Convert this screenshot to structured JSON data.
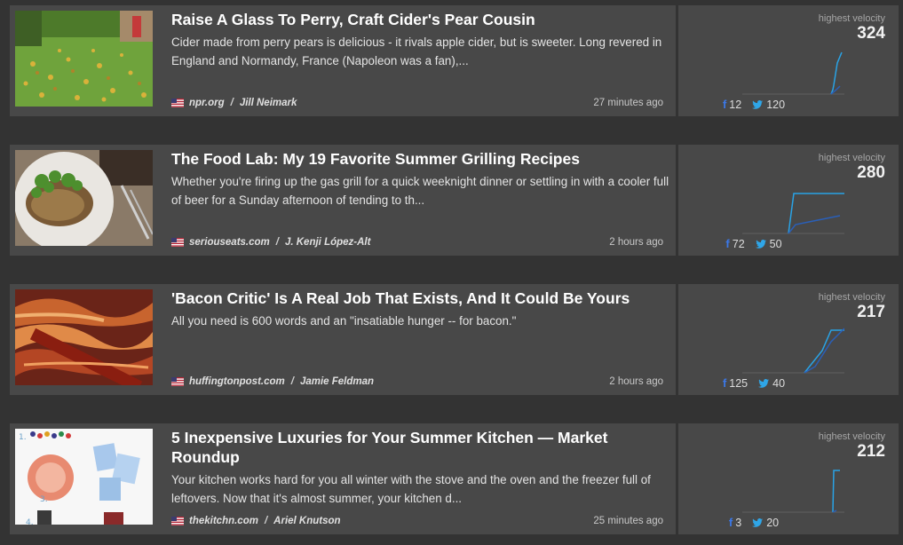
{
  "articles": [
    {
      "title": "Raise A Glass To Perry, Craft Cider's Pear Cousin",
      "description": "Cider made from perry pears is delicious - it rivals apple cider, but is sweeter. Long revered in England and Normandy, France (Napoleon was a fan),...",
      "source": "npr.org",
      "author": "Jill Neimark",
      "time": "27 minutes ago",
      "velocity_label": "highest velocity",
      "velocity": "324",
      "facebook": "12",
      "twitter": "120"
    },
    {
      "title": "The Food Lab: My 19 Favorite Summer Grilling Recipes",
      "description": "Whether you're firing up the gas grill for a quick weeknight dinner or settling in with a cooler full of beer for a Sunday afternoon of tending to th...",
      "source": "seriouseats.com",
      "author": "J. Kenji López-Alt",
      "time": "2 hours ago",
      "velocity_label": "highest velocity",
      "velocity": "280",
      "facebook": "72",
      "twitter": "50"
    },
    {
      "title": "'Bacon Critic' Is A Real Job That Exists, And It Could Be Yours",
      "description": "All you need is 600 words and an \"insatiable hunger -- for bacon.\"",
      "source": "huffingtonpost.com",
      "author": "Jamie Feldman",
      "time": "2 hours ago",
      "velocity_label": "highest velocity",
      "velocity": "217",
      "facebook": "125",
      "twitter": "40"
    },
    {
      "title": "5 Inexpensive Luxuries for Your Summer Kitchen — Market Roundup",
      "description": "Your kitchen works hard for you all winter with the stove and the oven and the freezer full of leftovers. Now that it's almost summer, your kitchen d...",
      "source": "thekitchn.com",
      "author": "Ariel Knutson",
      "time": "25 minutes ago",
      "velocity_label": "highest velocity",
      "velocity": "212",
      "facebook": "3",
      "twitter": "20"
    }
  ],
  "colors": {
    "background": "#333333",
    "card": "#484848",
    "facebook": "#3b78e7",
    "twitter": "#2fa6e8",
    "sparkline": "#29a3e6"
  }
}
